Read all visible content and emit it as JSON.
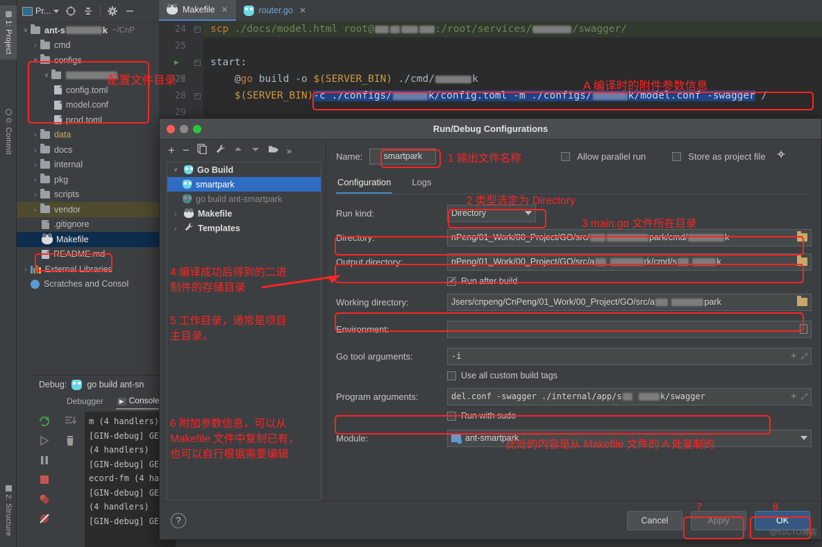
{
  "app": {
    "left_strip": [
      {
        "label": "1: Project",
        "selected": true
      },
      {
        "label": "0: Commit",
        "selected": false
      },
      {
        "label": "2: Structure",
        "selected": false
      }
    ]
  },
  "project_panel": {
    "title": "Pr...",
    "icons": [
      "project-select-icon",
      "locate-icon",
      "collapse-all-icon",
      "settings-gear-icon",
      "minimize-icon"
    ],
    "tree": [
      {
        "label": "ant-s████k",
        "path_hint": "~/CnP",
        "type": "root",
        "arrow": "v",
        "indent": 0
      },
      {
        "label": "cmd",
        "type": "folder",
        "arrow": ">",
        "indent": 1
      },
      {
        "label": "configs",
        "type": "folder",
        "arrow": "v",
        "indent": 1
      },
      {
        "label": "████k",
        "type": "folder",
        "arrow": "v",
        "indent": 2
      },
      {
        "label": "config.toml",
        "type": "file",
        "arrow": "",
        "indent": 3
      },
      {
        "label": "model.conf",
        "type": "file",
        "arrow": "",
        "indent": 3
      },
      {
        "label": "prod.toml",
        "type": "file",
        "arrow": "",
        "indent": 3
      },
      {
        "label": "data",
        "type": "folder",
        "arrow": ">",
        "indent": 1,
        "highlight_text": true
      },
      {
        "label": "docs",
        "type": "folder",
        "arrow": ">",
        "indent": 1
      },
      {
        "label": "internal",
        "type": "folder",
        "arrow": ">",
        "indent": 1
      },
      {
        "label": "pkg",
        "type": "folder",
        "arrow": ">",
        "indent": 1
      },
      {
        "label": "scripts",
        "type": "folder",
        "arrow": ">",
        "indent": 1
      },
      {
        "label": "vendor",
        "type": "folder",
        "arrow": ">",
        "indent": 1,
        "row_highlight": "olive"
      },
      {
        "label": ".gitignore",
        "type": "file",
        "arrow": "",
        "indent": 2
      },
      {
        "label": "Makefile",
        "type": "makefile",
        "arrow": "",
        "indent": 2,
        "row_highlight": "selected"
      },
      {
        "label": "README.md",
        "type": "file",
        "arrow": "",
        "indent": 2
      },
      {
        "label": "External Libraries",
        "type": "lib",
        "arrow": ">",
        "indent": 0
      },
      {
        "label": "Scratches and Consol",
        "type": "scratch",
        "arrow": "",
        "indent": 0
      }
    ]
  },
  "debug_panel": {
    "label": "Debug:",
    "config_name": "go build ant-sn",
    "tabs": [
      {
        "label": "Debugger",
        "active": false
      },
      {
        "label": "Console",
        "active": true
      }
    ],
    "console_lines": [
      "m (4 handlers)",
      "[GIN-debug] GET",
      "(4 handlers)",
      "[GIN-debug] GET",
      "ecord-fm (4 har",
      "[GIN-debug] GET",
      "(4 handlers)",
      "[GIN-debug] GET"
    ]
  },
  "editor": {
    "tabs": [
      {
        "label": "Makefile",
        "icon": "makefile-icon",
        "active": true
      },
      {
        "label": "router.go",
        "icon": "go-file-icon",
        "active": false
      }
    ],
    "line_numbers": [
      "24",
      "25",
      "26",
      "27",
      "28",
      "29"
    ],
    "lines": [
      {
        "no": "24",
        "segments": [
          {
            "t": "scp",
            "c": "orange"
          },
          {
            "t": " ./docs/model.html root@",
            "c": "green"
          },
          {
            "t": "██ ██ ███ ███",
            "c": "blur"
          },
          {
            "t": ":/root/services/",
            "c": "green"
          },
          {
            "t": "████k",
            "c": "blur"
          },
          {
            "t": "/swagger/",
            "c": "green"
          }
        ],
        "shell": true
      },
      {
        "no": "25",
        "segments": []
      },
      {
        "no": "26",
        "segments": [
          {
            "t": "start:",
            "c": "plain"
          }
        ],
        "run_marker": true
      },
      {
        "no": "27",
        "segments": [
          {
            "t": "@",
            "c": "plain"
          },
          {
            "t": "go",
            "c": "orange"
          },
          {
            "t": " build -o ",
            "c": "plain"
          },
          {
            "t": "$(SERVER_BIN)",
            "c": "gold"
          },
          {
            "t": " ./cmd/",
            "c": "plain"
          },
          {
            "t": "████ k",
            "c": "blur"
          }
        ]
      },
      {
        "no": "28",
        "segments": [
          {
            "t": "$(SERVER_BIN)",
            "c": "gold"
          },
          {
            "t": "-c ./configs/████k/config.toml -m ./configs/████k/model.conf -swagger",
            "c": "sel"
          },
          {
            "t": " /",
            "c": "plain"
          }
        ]
      }
    ]
  },
  "dialog": {
    "title": "Run/Debug Configurations",
    "traffic_lights": [
      "#ff5f57",
      "#8a8a8a",
      "#28c840"
    ],
    "left_toolbar": [
      "add-icon",
      "remove-icon",
      "copy-icon",
      "edit-templates-icon",
      "move-up-icon",
      "move-down-icon",
      "new-folder-icon",
      "more-icon"
    ],
    "config_tree": [
      {
        "label": "Go Build",
        "arrow": "v",
        "indent": 0,
        "icon": "go-build-icon",
        "bold": true
      },
      {
        "label": "smartpark",
        "arrow": "",
        "indent": 1,
        "icon": "go-build-icon",
        "selected": true
      },
      {
        "label": "go build ant-smartpark",
        "arrow": "",
        "indent": 1,
        "icon": "go-build-icon",
        "dim": true
      },
      {
        "label": "Makefile",
        "arrow": ">",
        "indent": 0,
        "icon": "makefile-icon",
        "bold": true
      },
      {
        "label": "Templates",
        "arrow": ">",
        "indent": 0,
        "icon": "wrench-icon",
        "bold": true
      }
    ],
    "name_label": "Name:",
    "name_value": "smartpark",
    "allow_parallel_run": {
      "label": "Allow parallel run",
      "checked": false
    },
    "store_as_project_file": {
      "label": "Store as project file",
      "checked": false
    },
    "tabs": [
      {
        "label": "Configuration",
        "active": true
      },
      {
        "label": "Logs",
        "active": false
      }
    ],
    "fields": {
      "run_kind": {
        "label": "Run kind:",
        "value": "Directory"
      },
      "directory": {
        "label": "Directory:",
        "value": "nPeng/01_Work/00_Project/GO/src/███ ████park/cmd/██ ████k"
      },
      "output_directory": {
        "label": "Output directory:",
        "value": "nPeng/01_Work/00_Project/GO/src/a██  ████rk/cmd/s██  ███k"
      },
      "run_after_build": {
        "label": "Run after build",
        "checked": true
      },
      "working_directory": {
        "label": "Working directory:",
        "value": "Jsers/cnpeng/CnPeng/01_Work/00_Project/GO/src/a██ ████park"
      },
      "environment": {
        "label": "Environment:",
        "value": ""
      },
      "go_tool_arguments": {
        "label": "Go tool arguments:",
        "value": "-i"
      },
      "use_all_custom_build_tags": {
        "label": "Use all custom build tags",
        "checked": false
      },
      "program_arguments": {
        "label": "Program arguments:",
        "value": "del.conf -swagger ./internal/app/s██ ███k/swagger"
      },
      "run_with_sudo": {
        "label": "Run with sudo",
        "checked": false
      },
      "module": {
        "label": "Module:",
        "value": "ant-smartpark"
      }
    },
    "footer": {
      "help": "?",
      "cancel": "Cancel",
      "apply": "Apply",
      "ok": "OK"
    }
  },
  "annotations": {
    "accent_color": "#fb2424",
    "notes": [
      {
        "id": "a-note",
        "text": "A 编译时的附件参数信息"
      },
      {
        "id": "configs-note",
        "text": "配置文件目录"
      },
      {
        "id": "note-1",
        "text": "1 输出文件名称"
      },
      {
        "id": "note-2",
        "text": "2 类型选定为 Directory"
      },
      {
        "id": "note-3",
        "text": "3 main.go 文件所在目录"
      },
      {
        "id": "note-4",
        "text": "4 编译成功后得到的二进\n制件的存储目录"
      },
      {
        "id": "note-5",
        "text": "5 工作目录，通常是项目\n主目录。"
      },
      {
        "id": "note-6",
        "text": "6 附加参数信息，可以从\nMakefile 文件中复制已有，\n也可以自行根据需要编辑"
      },
      {
        "id": "note-copied",
        "text": "此处的内容是从 Makefile 文件的 A 处复制的"
      },
      {
        "id": "note-7",
        "text": "7"
      },
      {
        "id": "note-8",
        "text": "8"
      }
    ]
  },
  "watermark": "@51CTO博客"
}
